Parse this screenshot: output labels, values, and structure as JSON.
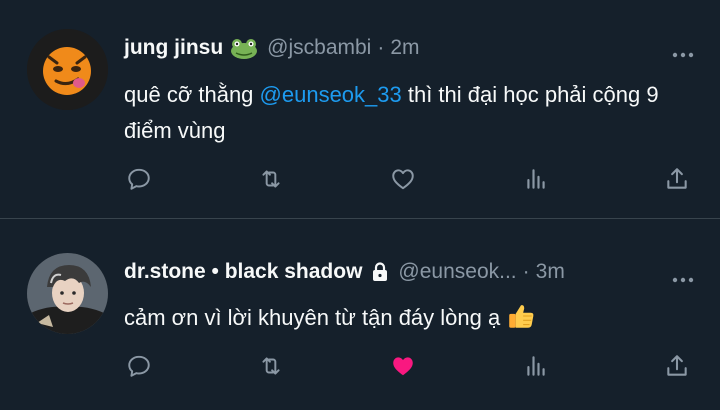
{
  "tweets": [
    {
      "display_name": "jung jinsu",
      "name_emoji": "frog-emoji",
      "handle": "@jscbambi",
      "separator": "·",
      "time": "2m",
      "text_before": "quê cỡ thằng ",
      "mention": "@eunseok_33",
      "text_after": " thì thi đại học phải cộng 9 điểm vùng",
      "liked": false
    },
    {
      "display_name": "dr.stone • black shadow",
      "protected": true,
      "handle": "@eunseok...",
      "separator": "·",
      "time": "3m",
      "text": "cảm ơn vì lời khuyên từ tận đáy lòng ạ",
      "text_emoji": "thumbs-up-emoji",
      "liked": true
    }
  ],
  "colors": {
    "background": "#15202b",
    "divider": "#38444d",
    "secondary_text": "#8b98a5",
    "mention": "#1d9bf0",
    "like_active": "#f91880"
  }
}
